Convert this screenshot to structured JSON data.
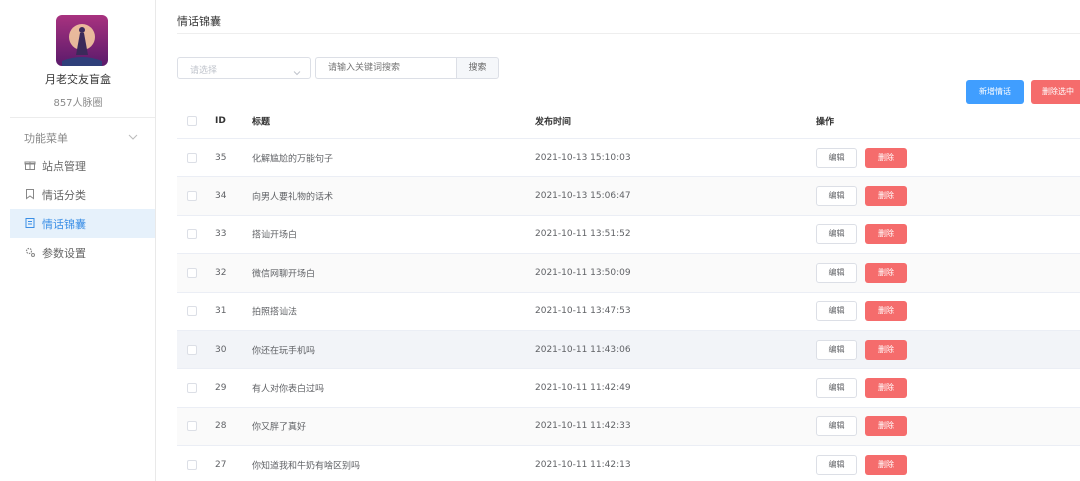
{
  "sidebar": {
    "site_name": "月老交友盲盒",
    "site_sub": "857人脉圈",
    "group_label": "功能菜单",
    "items": [
      {
        "label": "站点管理",
        "icon": "gift-icon"
      },
      {
        "label": "情话分类",
        "icon": "bookmark-icon"
      },
      {
        "label": "情话锦囊",
        "icon": "document-icon",
        "active": true
      },
      {
        "label": "参数设置",
        "icon": "gear-icon"
      }
    ]
  },
  "main": {
    "title": "情话锦囊",
    "select_placeholder": "请选择",
    "search_placeholder": "请输入关键词搜索",
    "search_label": "搜索",
    "add_label": "新增情话",
    "delete_selected_label": "删除选中"
  },
  "table": {
    "headers": {
      "id": "ID",
      "title": "标题",
      "time": "发布时间",
      "ops": "操作"
    },
    "edit_label": "编辑",
    "delete_label": "删除",
    "rows": [
      {
        "id": "35",
        "title": "化解尴尬的万能句子",
        "time": "2021-10-13 15:10:03"
      },
      {
        "id": "34",
        "title": "向男人要礼物的话术",
        "time": "2021-10-13 15:06:47"
      },
      {
        "id": "33",
        "title": "搭讪开场白",
        "time": "2021-10-11 13:51:52"
      },
      {
        "id": "32",
        "title": "微信网聊开场白",
        "time": "2021-10-11 13:50:09"
      },
      {
        "id": "31",
        "title": "拍照搭讪法",
        "time": "2021-10-11 13:47:53"
      },
      {
        "id": "30",
        "title": "你还在玩手机吗",
        "time": "2021-10-11 11:43:06"
      },
      {
        "id": "29",
        "title": "有人对你表白过吗",
        "time": "2021-10-11 11:42:49"
      },
      {
        "id": "28",
        "title": "你又胖了真好",
        "time": "2021-10-11 11:42:33"
      },
      {
        "id": "27",
        "title": "你知道我和牛奶有啥区别吗",
        "time": "2021-10-11 11:42:13"
      }
    ]
  },
  "colors": {
    "primary": "#409eff",
    "danger": "#f56c6c",
    "active_bg": "#e6f1fb",
    "logo_bg": "#8b2a7a"
  }
}
